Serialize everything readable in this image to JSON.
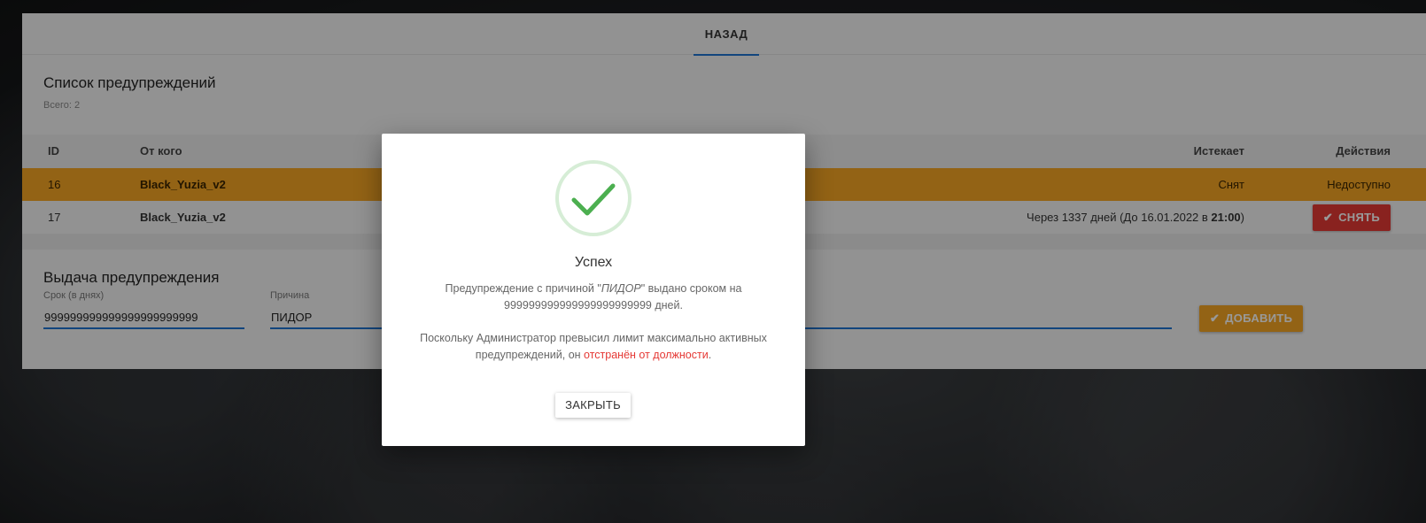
{
  "nav": {
    "back_label": "НАЗАД"
  },
  "warnings_list": {
    "title": "Список предупреждений",
    "count_text": "Всего: 2",
    "columns": {
      "id": "ID",
      "from": "От кого",
      "expires": "Истекает",
      "actions": "Действия"
    },
    "rows": [
      {
        "id": "16",
        "from": "Black_Yuzia_v2",
        "expires": "Снят",
        "action": "Недоступно"
      },
      {
        "id": "17",
        "from": "Black_Yuzia_v2",
        "expires_prefix": "Через 1337 дней (До 16.01.2022 в ",
        "expires_time": "21:00",
        "expires_suffix": ")",
        "action": "СНЯТЬ"
      }
    ]
  },
  "issue_form": {
    "title": "Выдача предупреждения",
    "term_label": "Срок (в днях)",
    "term_value": "999999999999999999999999",
    "reason_label": "Причина",
    "reason_value": "ПИДОР",
    "add_label": "ДОБАВИТЬ"
  },
  "modal": {
    "title": "Успех",
    "line1_prefix": "Предупреждение с причиной \"",
    "line1_reason": "ПИДОР",
    "line1_suffix": "\" выдано сроком на",
    "line2": "999999999999999999999999 дней.",
    "line3": "Поскольку Администратор превысил лимит максимально активных",
    "line4_prefix": "предупреждений, он ",
    "line4_red": "отстранён от должности",
    "line4_suffix": ".",
    "close_label": "ЗАКРЫТЬ"
  },
  "colors": {
    "accent": "#1e73d0",
    "orange": "#f5a623",
    "red": "#e53935",
    "success": "#4caf50"
  }
}
